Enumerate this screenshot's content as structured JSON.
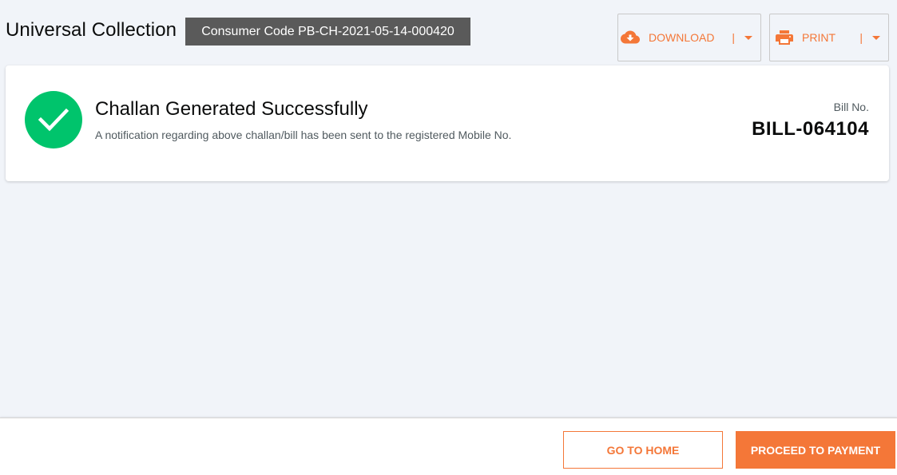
{
  "header": {
    "title": "Universal Collection",
    "consumer_code": "Consumer Code PB-CH-2021-05-14-000420",
    "download": {
      "label": "DOWNLOAD",
      "separator": "|",
      "icon": "cloud-download-icon"
    },
    "print": {
      "label": "PRINT",
      "separator": "|",
      "icon": "printer-icon"
    }
  },
  "card": {
    "status_icon": "check-icon",
    "title": "Challan Generated Successfully",
    "message": "A notification regarding above challan/bill has been sent to the registered Mobile No.",
    "bill_label": "Bill No.",
    "bill_number": "BILL-064104"
  },
  "footer": {
    "home_label": "GO TO HOME",
    "pay_label": "PROCEED TO PAYMENT"
  },
  "colors": {
    "accent": "#f47738",
    "success": "#00c46c",
    "background": "#f1f4f9",
    "badge": "#5a5a5a"
  }
}
